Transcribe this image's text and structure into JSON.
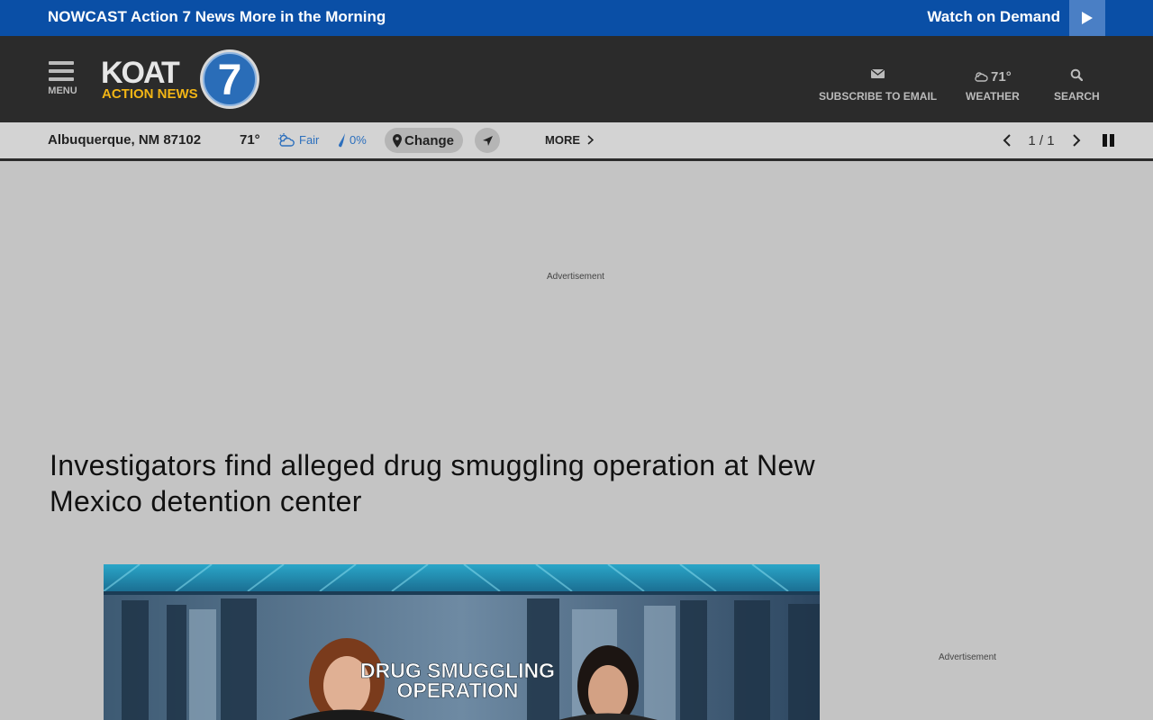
{
  "topbar": {
    "nowcast_label": "NOWCAST",
    "nowcast_title": "Action 7 News More in the Morning",
    "watch_label": "Watch on Demand"
  },
  "header": {
    "menu_label": "MENU",
    "logo_text": "KOAT",
    "logo_subtext": "ACTION NEWS",
    "logo_number": "7",
    "subscribe_label": "SUBSCRIBE TO EMAIL",
    "weather_temp": "71°",
    "weather_label": "WEATHER",
    "search_label": "SEARCH"
  },
  "weather_bar": {
    "location": "Albuquerque, NM 87102",
    "temperature": "71°",
    "condition": "Fair",
    "precip": "0%",
    "change_label": "Change",
    "more_label": "MORE",
    "pager": "1 / 1"
  },
  "ads": {
    "top_label": "Advertisement",
    "side_label": "Advertisement"
  },
  "article": {
    "headline": "Investigators find alleged drug smuggling operation at New Mexico detention center"
  },
  "video": {
    "graphic_line1": "DRUG SMUGGLING",
    "graphic_line2": "OPERATION"
  },
  "colors": {
    "topbar": "#0a4fa6",
    "header": "#2b2b2b",
    "page": "#c4c4c4",
    "logo_gold": "#f2b515",
    "weather_blue": "#2c6fbd"
  }
}
